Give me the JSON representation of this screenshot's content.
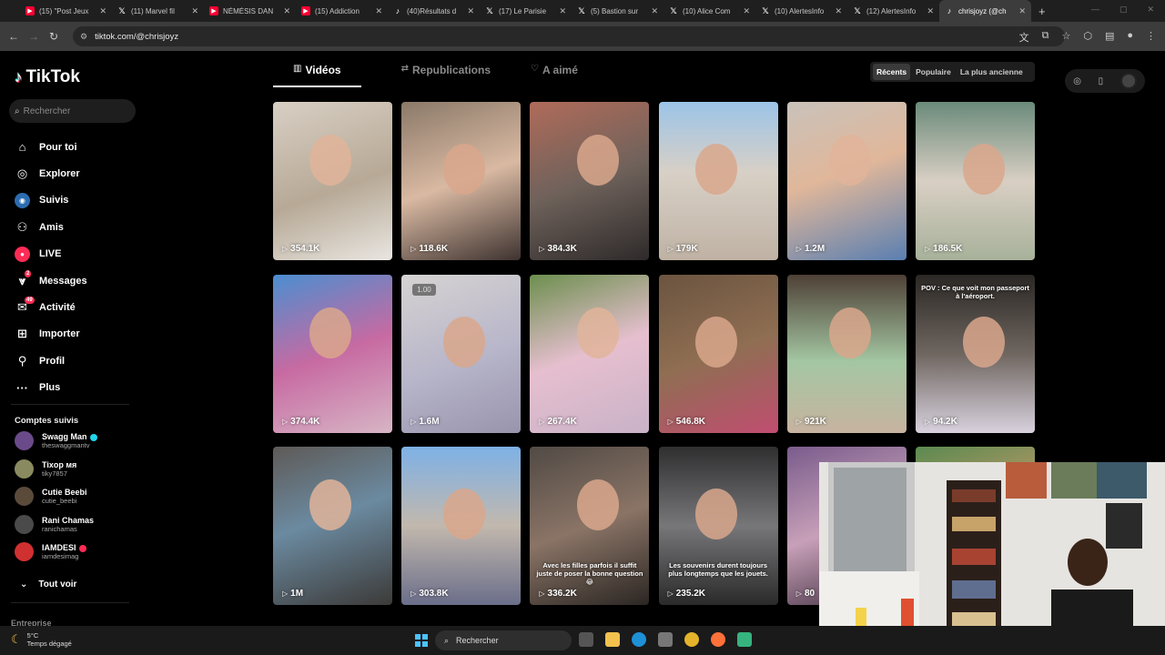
{
  "browser": {
    "tabs": [
      {
        "title": "(15) \"Post Jeux",
        "icon": "youtube-icon",
        "active": false
      },
      {
        "title": "(11) Marvel fil",
        "icon": "x-icon",
        "active": false
      },
      {
        "title": "NÉMÉSIS DAN",
        "icon": "youtube-icon",
        "active": false
      },
      {
        "title": "(15) Addiction",
        "icon": "youtube-icon",
        "active": false
      },
      {
        "title": "(40)Résultats d",
        "icon": "tiktok-icon",
        "active": false
      },
      {
        "title": "(17) Le Parisie",
        "icon": "x-icon",
        "active": false
      },
      {
        "title": "(5) Bastion sur",
        "icon": "x-icon",
        "active": false
      },
      {
        "title": "(10) Alice Com",
        "icon": "x-icon",
        "active": false
      },
      {
        "title": "(10) AlertesInfo",
        "icon": "x-icon",
        "active": false
      },
      {
        "title": "(12) AlertesInfo",
        "icon": "x-icon",
        "active": false
      },
      {
        "title": "chrisjoyz (@ch",
        "icon": "tiktok-icon",
        "active": true
      }
    ],
    "url": "tiktok.com/@chrisjoyz"
  },
  "sidebar": {
    "logo": "TikTok",
    "search_placeholder": "Rechercher",
    "nav": [
      {
        "label": "Pour toi",
        "icon": "home-icon"
      },
      {
        "label": "Explorer",
        "icon": "compass-icon"
      },
      {
        "label": "Suivis",
        "icon": "following-icon"
      },
      {
        "label": "Amis",
        "icon": "friends-icon"
      },
      {
        "label": "LIVE",
        "icon": "live-icon"
      },
      {
        "label": "Messages",
        "icon": "messages-icon",
        "badge": "2"
      },
      {
        "label": "Activité",
        "icon": "activity-icon",
        "badge": "49"
      },
      {
        "label": "Importer",
        "icon": "upload-icon"
      },
      {
        "label": "Profil",
        "icon": "profile-icon"
      },
      {
        "label": "Plus",
        "icon": "more-icon"
      }
    ],
    "follows_title": "Comptes suivis",
    "follows": [
      {
        "name": "Swagg Man",
        "handle": "theswaggmantv",
        "verified": true
      },
      {
        "name": "Tixop мя",
        "handle": "tiky7857"
      },
      {
        "name": "Cutie Beebi",
        "handle": "cutie_beebi"
      },
      {
        "name": "Rani Chamas",
        "handle": "ranichamas"
      },
      {
        "name": "IAMDESI",
        "handle": "iamdesimag",
        "red_badge": true
      }
    ],
    "see_all": "Tout voir",
    "footer": "Entreprise"
  },
  "profile": {
    "tabs": [
      "Vidéos",
      "Republications",
      "A aimé"
    ],
    "sort": [
      "Récents",
      "Populaire",
      "La plus ancienne"
    ]
  },
  "videos": [
    {
      "views": "354.1K"
    },
    {
      "views": "118.6K"
    },
    {
      "views": "384.3K"
    },
    {
      "views": "179K"
    },
    {
      "views": "1.2M"
    },
    {
      "views": "186.5K"
    },
    {
      "views": "374.4K"
    },
    {
      "views": "1.6M",
      "speed": "1.00"
    },
    {
      "views": "267.4K"
    },
    {
      "views": "546.8K"
    },
    {
      "views": "921K"
    },
    {
      "views": "94.2K",
      "caption": "POV : Ce que voit mon passeport à l'aéroport."
    },
    {
      "views": "1M"
    },
    {
      "views": "303.8K"
    },
    {
      "views": "336.2K",
      "caption": "Avec les filles parfois il suffit juste de poser la bonne question😂"
    },
    {
      "views": "235.2K",
      "caption": "Les souvenirs durent toujours plus longtemps que les jouets."
    },
    {
      "views": "80"
    },
    {
      "views": ""
    }
  ],
  "taskbar": {
    "temp": "5°C",
    "weather": "Temps dégagé",
    "search": "Rechercher"
  }
}
